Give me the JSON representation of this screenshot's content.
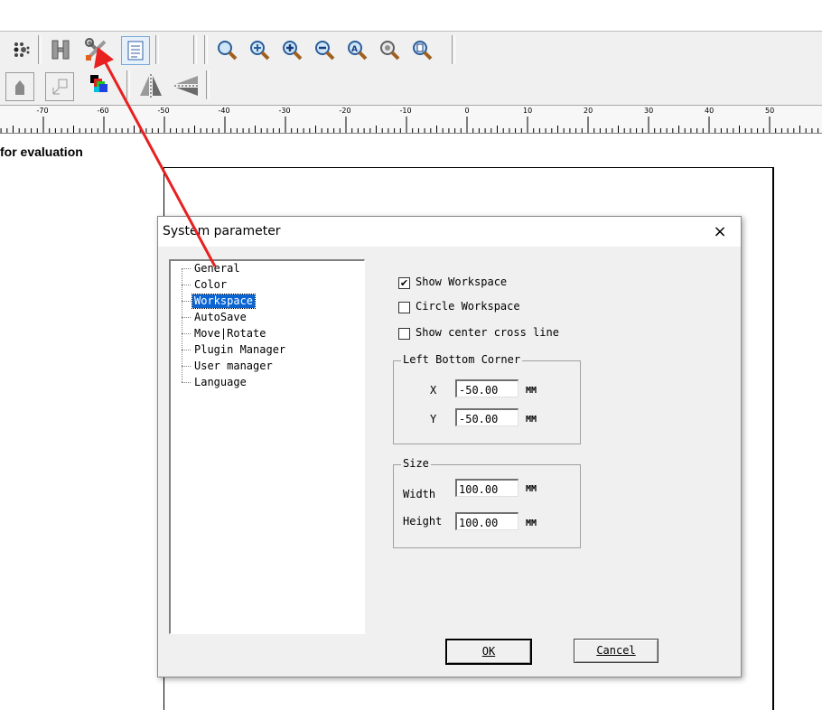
{
  "canvas": {
    "evaluation_text": "for evaluation",
    "ruler_labels": [
      "-70",
      "-60",
      "-50",
      "-40",
      "-30",
      "-20",
      "-10",
      "0",
      "10",
      "20",
      "30",
      "40",
      "50"
    ]
  },
  "dialog": {
    "title": "System parameter",
    "close_symbol": "×",
    "tree_items": [
      "General",
      "Color",
      "Workspace",
      "AutoSave",
      "Move|Rotate",
      "Plugin Manager",
      "User manager",
      "Language"
    ],
    "selected_item": "Workspace",
    "options": {
      "show_workspace": {
        "label": "Show Workspace",
        "checked": true
      },
      "circle_workspace": {
        "label": "Circle Workspace",
        "checked": false
      },
      "show_center_cross_line": {
        "label": "Show center cross line",
        "checked": false
      }
    },
    "left_bottom_corner": {
      "title": "Left Bottom Corner",
      "x_label": "X",
      "x_value": "-50.00",
      "y_label": "Y",
      "y_value": "-50.00",
      "unit": "MM"
    },
    "size": {
      "title": "Size",
      "width_label": "Width",
      "width_value": "100.00",
      "height_label": "Height",
      "height_value": "100.00",
      "unit": "MM"
    },
    "ok_label": "OK",
    "cancel_label": "Cancel"
  },
  "colors": {
    "selection": "#0a64d2",
    "arrow": "#e82020"
  }
}
